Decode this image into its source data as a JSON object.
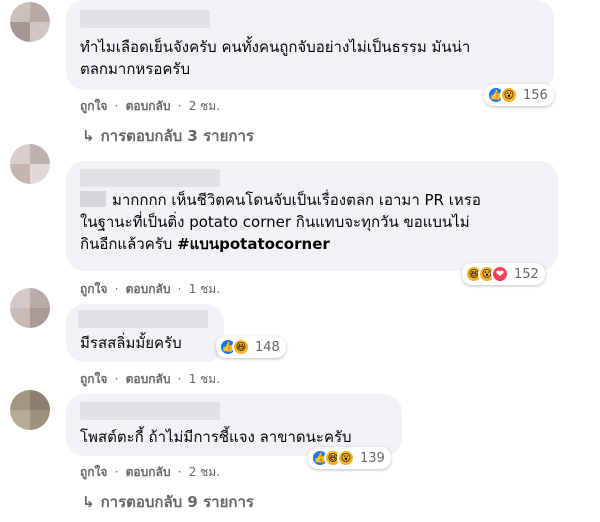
{
  "colors": {
    "bubble": "#f0f2f5",
    "meta": "#65676b",
    "like": "#1877f2",
    "emoji": "#f7b125",
    "love": "#f33e58"
  },
  "labels": {
    "like": "ถูกใจ",
    "reply": "ตอบกลับ",
    "dot": "·"
  },
  "comments": [
    {
      "lines": [
        "ทำไมเลือดเย็นจังครับ คนทั้งคนถูกจับอย่างไม่เป็นธรรม มันน่า",
        "ตลกมากหรอครับ"
      ],
      "time": "2 ชม.",
      "reactions": [
        "like-icon",
        "wow-icon"
      ],
      "reaction_count": "156",
      "replies_label": "การตอบกลับ 3 รายการ"
    },
    {
      "lines": [
        "มากกกก เห็นชีวิตคนโดนจับเป็นเรื่องตลก เอามา PR เหรอ",
        "ในฐานะที่เป็นติ่ง potato corner กินแทบจะทุกวัน ขอแบนไม่",
        "กินอีกแล้วครับ "
      ],
      "hashtag": "#แบนpotatocorner",
      "time": "1 ชม.",
      "reactions": [
        "haha-icon",
        "wow-icon",
        "love-icon"
      ],
      "reaction_count": "152"
    },
    {
      "lines": [
        "มีรสสลิ่มมั้ยครับ"
      ],
      "time": "1 ชม.",
      "reactions": [
        "like-icon",
        "haha-icon"
      ],
      "reaction_count": "148"
    },
    {
      "lines": [
        "โพสต์ตะกี้ ถ้าไม่มีการชี้แจง ลาขาดนะครับ"
      ],
      "time": "2 ชม.",
      "reactions": [
        "like-icon",
        "haha-icon",
        "wow-icon"
      ],
      "reaction_count": "139",
      "replies_label": "การตอบกลับ 9 รายการ"
    }
  ]
}
